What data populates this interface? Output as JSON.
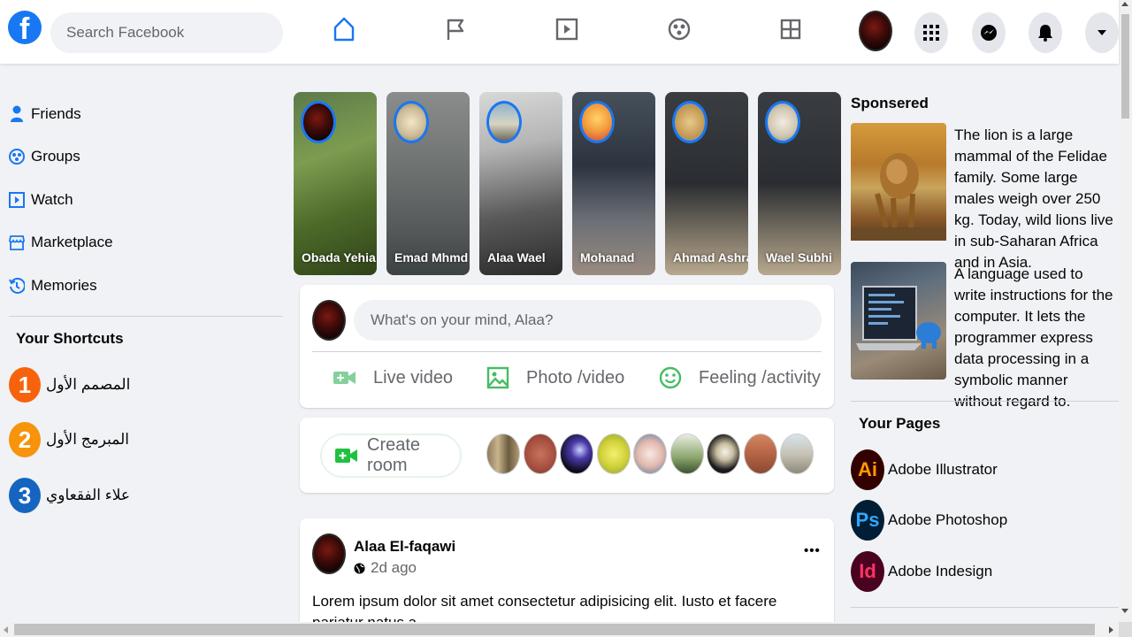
{
  "header": {
    "logo_letter": "f",
    "search_placeholder": "Search Facebook"
  },
  "sidebar": {
    "items": [
      {
        "label": "Friends",
        "icon": "friends-icon"
      },
      {
        "label": "Groups",
        "icon": "groups-icon"
      },
      {
        "label": "Watch",
        "icon": "watch-icon"
      },
      {
        "label": "Marketplace",
        "icon": "marketplace-icon"
      },
      {
        "label": "Memories",
        "icon": "memories-icon"
      }
    ],
    "shortcuts_title": "Your Shortcuts",
    "shortcuts": [
      {
        "number": "1",
        "label": "المصمم الأول",
        "color": "#f7630c"
      },
      {
        "number": "2",
        "label": "المبرمج الأول",
        "color": "#f7630c"
      },
      {
        "number": "3",
        "label": "علاء الفقعاوي",
        "color": "#1877f2"
      }
    ]
  },
  "stories": [
    {
      "name": "Obada Yehia"
    },
    {
      "name": "Emad Mhmd"
    },
    {
      "name": "Alaa Wael"
    },
    {
      "name": "Mohanad"
    },
    {
      "name": "Ahmad Ashraf"
    },
    {
      "name": "Wael Subhi"
    }
  ],
  "composer": {
    "placeholder": "What's on your mind, Alaa?",
    "actions": [
      {
        "label": "Live video",
        "icon": "live-video-icon",
        "color": "#45bd62"
      },
      {
        "label": "Photo /video",
        "icon": "photo-icon",
        "color": "#45bd62"
      },
      {
        "label": "Feeling /activity",
        "icon": "feeling-icon",
        "color": "#45bd62"
      }
    ]
  },
  "rooms": {
    "create_label": "Create room"
  },
  "post": {
    "author": "Alaa El-faqawi",
    "time": "2d ago",
    "more": "•••",
    "text": "Lorem ipsum dolor sit amet consectetur adipisicing elit. Iusto et facere pariatur natus a"
  },
  "right": {
    "sponsored_title": "Sponsered",
    "ads": [
      {
        "text": "The lion is a large mammal of the Felidae family. Some large males weigh over 250 kg. Today, wild lions live in sub-Saharan Africa and in Asia."
      },
      {
        "text": "A language used to write instructions for the computer. It lets the programmer express data processing in a symbolic manner without regard to."
      }
    ],
    "pages_title": "Your Pages",
    "pages": [
      {
        "abbr": "Ai",
        "label": "Adobe Illustrator",
        "bg": "#330000",
        "fg": "#ff9a00"
      },
      {
        "abbr": "Ps",
        "label": "Adobe Photoshop",
        "bg": "#001e36",
        "fg": "#31a8ff"
      },
      {
        "abbr": "Id",
        "label": "Adobe Indesign",
        "bg": "#49021f",
        "fg": "#ff3366"
      }
    ]
  },
  "colors": {
    "brand": "#1877f2",
    "accent_green": "#45bd62"
  }
}
